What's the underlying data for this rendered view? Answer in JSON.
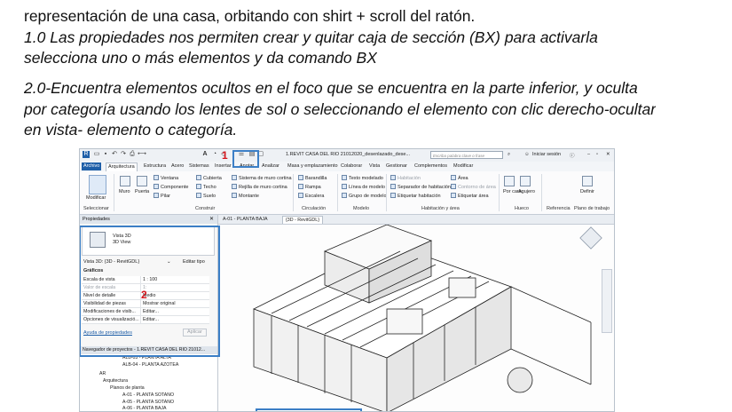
{
  "document": {
    "line_top": "representación de una casa, orbitando con shirt + scroll del ratón.",
    "p1_line1": "1.0 Las propiedades nos permiten crear y quitar caja de sección (BX) para activarla",
    "p1_line2": "selecciona uno o más elementos y da comando BX",
    "p2_line1": "2.0-Encuentra elementos ocultos en el foco que se encuentra en la parte inferior, y oculta",
    "p2_line2": "por categoría usando los lentes de sol o seleccionando el elemento con clic derecho-ocultar",
    "p2_line3": "en vista- elemento o categoría."
  },
  "revit": {
    "title_bar": "1.REVIT CASA DEL RIO 21012020_desenlazado_dese...",
    "search_placeholder": "Escriba palabra clave o frase",
    "sign_in": "Iniciar sesión",
    "tabs": [
      "Archivo",
      "Arquitectura",
      "Estructura",
      "Acero",
      "Sistemas",
      "Insertar",
      "Anotar",
      "Analizar",
      "Masa y emplazamiento",
      "Colaborar",
      "Vista",
      "Gestionar",
      "Complementos",
      "Modificar"
    ],
    "ribbon": {
      "modify": "Modificar",
      "select": "Seleccionar",
      "muro": "Muro",
      "puerta": "Puerta",
      "ventana": "Ventana",
      "componente": "Componente",
      "pilar": "Pilar",
      "cubierta": "Cubierta",
      "techo": "Techo",
      "suelo": "Suelo",
      "sistema_muro": "Sistema de muro cortina",
      "rejilla": "Rejilla de muro cortina",
      "montante": "Montante",
      "construir": "Construir",
      "barandilla": "Barandilla",
      "rampa": "Rampa",
      "escalera": "Escalera",
      "circulacion": "Circulación",
      "texto_modelado": "Texto modelado",
      "linea_modelo": "Línea de modelo",
      "grupo_modelo": "Grupo de modelo",
      "modelo": "Modelo",
      "habitacion": "Habitación",
      "separador": "Separador de habitación",
      "etiquetar_hab": "Etiquetar habitación",
      "area": "Área",
      "contorno_area": "Contorno de área",
      "etiquetar_area": "Etiquetar área",
      "hab_area": "Habitación y área",
      "por_cara": "Por cara",
      "agujero": "Agujero",
      "hueco": "Hueco",
      "definir": "Definir",
      "referencia": "Referencia",
      "plano_trabajo": "Plano de trabajo"
    },
    "properties": {
      "title": "Propiedades",
      "type_name": "Vista 3D",
      "type_sub": "3D View",
      "selector": "Vista 3D: {3D - RevitGDL}",
      "edit_type": "Editar tipo",
      "group": "Gráficos",
      "rows": [
        {
          "k": "Escala de vista",
          "v": "1 : 100"
        },
        {
          "k": "Valor de escala",
          "v": "1:"
        },
        {
          "k": "Nivel de detalle",
          "v": "Medio"
        },
        {
          "k": "Visibilidad de piezas",
          "v": "Mostrar original"
        },
        {
          "k": "Modificaciones de visib...",
          "v": "Editar..."
        },
        {
          "k": "Opciones de visualizació...",
          "v": "Editar..."
        }
      ],
      "help": "Ayuda de propiedades",
      "apply": "Aplicar"
    },
    "browser": {
      "title": "Navegador de proyectos - 1.REVIT CASA DEL RIO 21012...",
      "items": [
        "ALB-03 - PLANTA ALTA",
        "ALB-04 - PLANTA AZOTEA",
        "AR",
        "Arquitectura",
        "Planos de planta",
        "A-01 - PLANTA SOTANO",
        "A-05 - PLANTA SOTANO",
        "A-06 - PLANTA BAJA"
      ]
    },
    "view_tabs": [
      "A-01 - PLANTA BAJA",
      "{3D - RevitGDL}"
    ],
    "annotations": [
      "1",
      "2"
    ]
  }
}
